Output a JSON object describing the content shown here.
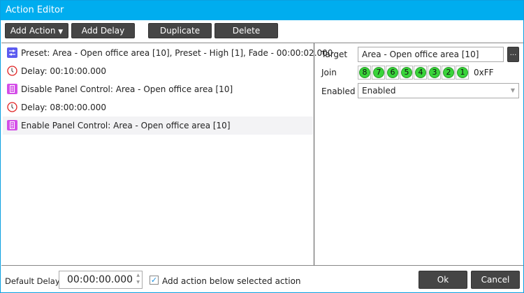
{
  "window": {
    "title": "Action Editor"
  },
  "toolbar": {
    "add_action": "Add Action",
    "add_delay": "Add Delay",
    "duplicate": "Duplicate",
    "delete": "Delete"
  },
  "actions": [
    {
      "type": "preset",
      "label": "Preset: Area - Open office area [10], Preset - High [1], Fade - 00:00:02.000"
    },
    {
      "type": "delay",
      "label": "Delay: 00:10:00.000"
    },
    {
      "type": "panel",
      "label": "Disable Panel Control: Area - Open office area [10]"
    },
    {
      "type": "delay",
      "label": "Delay: 08:00:00.000"
    },
    {
      "type": "panel",
      "label": "Enable Panel Control: Area - Open office area [10]",
      "selected": true
    }
  ],
  "properties": {
    "target_label": "Target",
    "target_value": "Area - Open office area [10]",
    "browse": "...",
    "join_label": "Join",
    "join_bits": [
      "8",
      "7",
      "6",
      "5",
      "4",
      "3",
      "2",
      "1"
    ],
    "join_hex": "0xFF",
    "enabled_label": "Enabled",
    "enabled_value": "Enabled"
  },
  "footer": {
    "default_delay_label": "Default Delay",
    "default_delay_value": "00:00:00.000",
    "add_below_label": "Add action below selected action",
    "add_below_checked": true,
    "ok": "Ok",
    "cancel": "Cancel"
  },
  "colors": {
    "title_bar": "#00adef",
    "preset_icon": "#5b5bf0",
    "panel_icon": "#d44ee8",
    "delay_icon": "#e02020",
    "join_bit_on": "#39d43a"
  }
}
